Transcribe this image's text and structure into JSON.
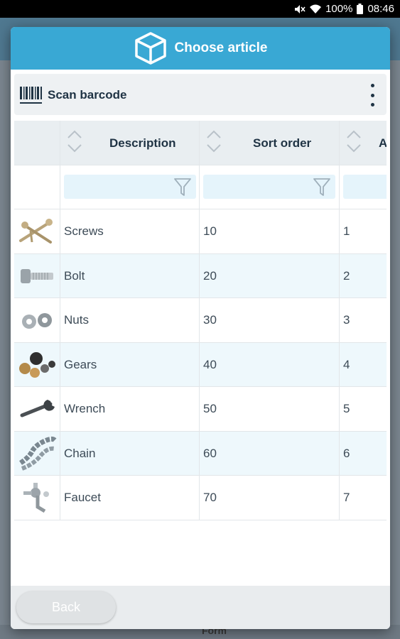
{
  "status_bar": {
    "battery": "100%",
    "time": "08:46"
  },
  "background": {
    "footer_text": "Form"
  },
  "dialog": {
    "title": "Choose article",
    "icon": "box-icon"
  },
  "toolbar": {
    "scan_label": "Scan barcode",
    "menu_icon": "more-vert-icon"
  },
  "table": {
    "columns": [
      "Description",
      "Sort order",
      "A"
    ],
    "rows": [
      {
        "image": "screws",
        "description": "Screws",
        "sort_order": "10",
        "a": "1"
      },
      {
        "image": "bolt",
        "description": "Bolt",
        "sort_order": "20",
        "a": "2"
      },
      {
        "image": "nuts",
        "description": "Nuts",
        "sort_order": "30",
        "a": "3"
      },
      {
        "image": "gears",
        "description": "Gears",
        "sort_order": "40",
        "a": "4"
      },
      {
        "image": "wrench",
        "description": "Wrench",
        "sort_order": "50",
        "a": "5"
      },
      {
        "image": "chain",
        "description": "Chain",
        "sort_order": "60",
        "a": "6"
      },
      {
        "image": "faucet",
        "description": "Faucet",
        "sort_order": "70",
        "a": "7"
      }
    ]
  },
  "footer": {
    "back_label": "Back"
  },
  "colors": {
    "accent": "#39a8d4",
    "row_alt": "#eef8fc",
    "filter_bg": "#e5f4fb"
  }
}
